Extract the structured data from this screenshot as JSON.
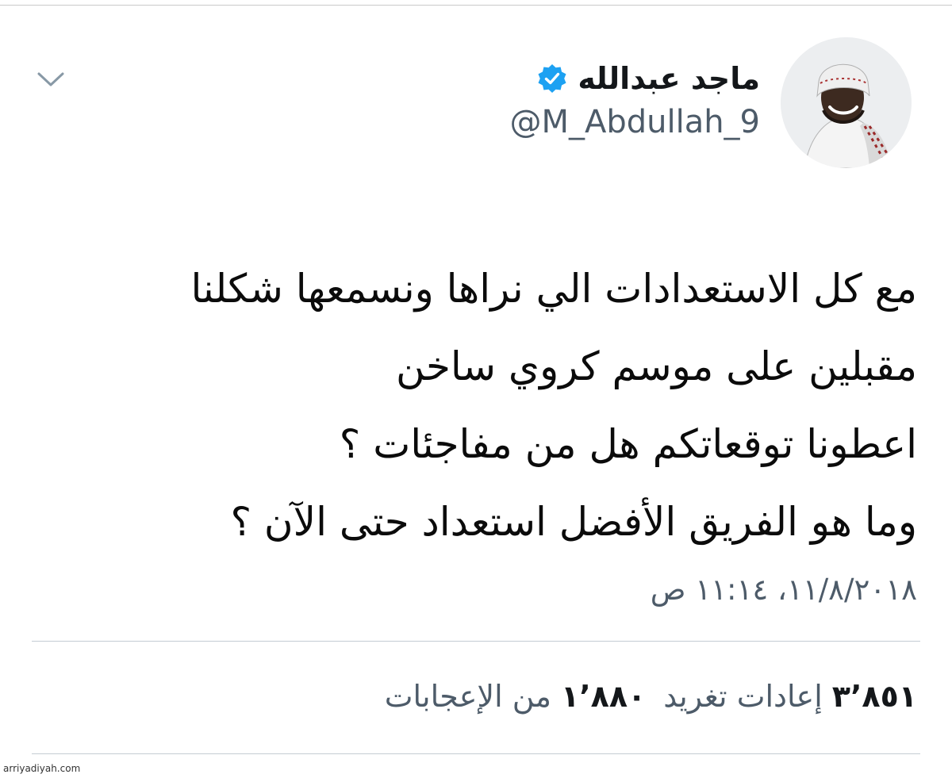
{
  "account": {
    "display_name": "ماجد عبدالله",
    "handle": "@M_Abdullah_9",
    "verified": true
  },
  "tweet": {
    "lines": [
      "مع كل الاستعدادات الي نراها ونسمعها شكلنا",
      "مقبلين على موسم كروي ساخن",
      "اعطونا توقعاتكم هل من مفاجئات ؟",
      "وما هو الفريق الأفضل استعداد حتى الآن ؟"
    ],
    "timestamp": "١١/٨/٢٠١٨، ١١:١٤ ص"
  },
  "stats": {
    "retweets_count": "٣٬٨٥١",
    "retweets_label": "إعادات تغريد",
    "likes_count": "١٬٨٨٠",
    "likes_label": "من الإعجابات"
  },
  "icons": {
    "menu": "chevron-down-icon",
    "verified": "verified-badge-icon"
  },
  "colors": {
    "verified_blue": "#1da1f2",
    "muted_text": "#4d5b69",
    "primary_text": "#14171a"
  },
  "watermark": "arriyadiyah.com"
}
